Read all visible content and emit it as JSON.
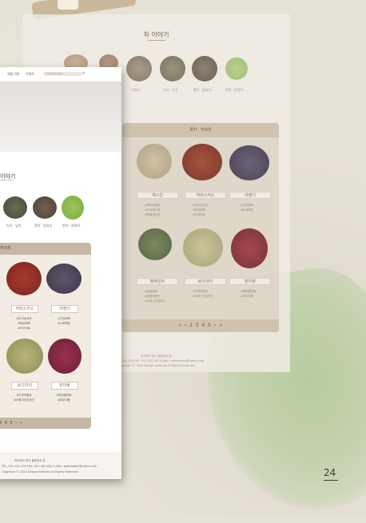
{
  "colors": {
    "accent_brown": "#8f6b4f",
    "panel": "#c6b8a3",
    "wash": "#b8cba0"
  },
  "back_page": {
    "section_title": "차 이야기",
    "tea_labels": [
      "러벤더",
      "녹차 · 잎차",
      "홍차 · 말효차",
      "현대 · 분말차"
    ],
    "panel_header": "꽃차 · 허브차",
    "items": [
      {
        "name": "재스민",
        "tags": [
          "#피부미용에",
          "#스트레스에",
          "#항혈관건강"
        ]
      },
      {
        "name": "히비스커스",
        "tags": [
          "#간기능개선",
          "#피로회복",
          "#다이어트"
        ]
      },
      {
        "name": "라벤더",
        "tags": [
          "#긴장완화",
          "#노화예방"
        ]
      },
      {
        "name": "페퍼민트",
        "tags": [
          "#호흡완화",
          "#집중력증가",
          "#소화기건강개선"
        ]
      },
      {
        "name": "로즈마리",
        "tags": [
          "#기억력향상",
          "#소화기건강개선"
        ]
      },
      {
        "name": "장미꽃",
        "tags": [
          "#변비통완화",
          "#피부미용"
        ]
      }
    ],
    "pager": "« ‹  2 3 4 5  › »",
    "footer": [
      "허브앤차 한국 블렌딩의 류",
      "TEL. 051-181-000  FAX. 051-181-000  E-Mail. webmaster@home.com",
      "Copyright © 2024 Design Institute All Rights Reserved"
    ]
  },
  "front_page": {
    "nav": [
      "제품구매",
      "이벤트"
    ],
    "search_placeholder": "검색어를 입력하세요",
    "section_title": "이야기",
    "tea_labels": [
      "녹차 · 잎차",
      "홍차 · 말효차",
      "현대 · 분말차"
    ],
    "panel_header": "허브차",
    "items": [
      {
        "name": "히비스커스",
        "tags": [
          "#간기능개선",
          "#피로회복",
          "#다이어트"
        ]
      },
      {
        "name": "라벤더",
        "tags": [
          "#긴장완화",
          "#노화예방"
        ]
      },
      {
        "name": "로즈마리",
        "tags": [
          "#기억력향상",
          "#소화기건강개선"
        ]
      },
      {
        "name": "장미꽃",
        "tags": [
          "#변비통완화",
          "#피부미용"
        ]
      }
    ],
    "pager": "3 4 5  › »",
    "footer": [
      "허브앤차 한국 블렌딩의 류",
      "TEL. 051-181-000  FAX. 051-181-000  E-Mail. webmaster@home.com",
      "Copyright © 2024 Design Institute All Rights Reserved"
    ]
  },
  "page_number": "24"
}
